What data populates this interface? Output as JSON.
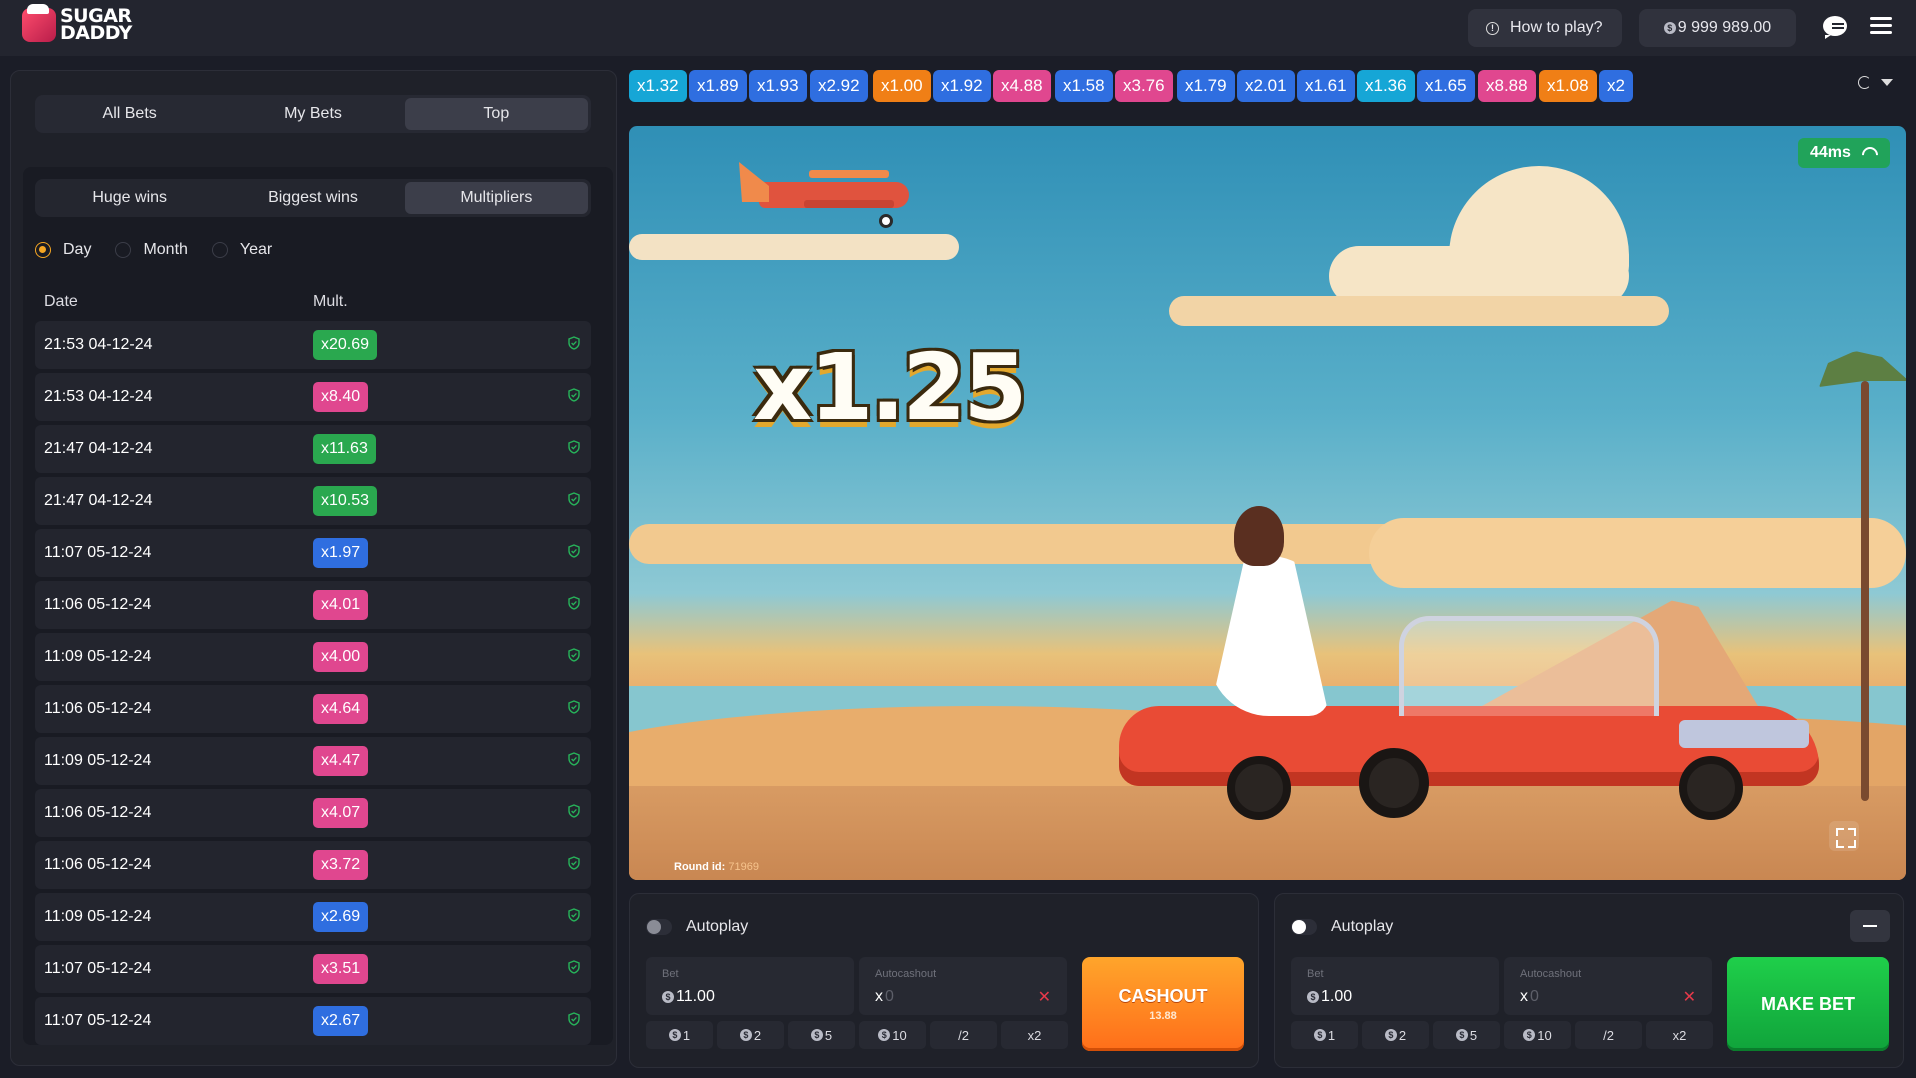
{
  "app": {
    "logo_line1": "SUGAR",
    "logo_line2": "DADDY"
  },
  "header": {
    "how_to_play": "How to play?",
    "balance": "9 999 989.00"
  },
  "bets_tabs": [
    "All Bets",
    "My Bets",
    "Top"
  ],
  "top_tabs": [
    "Huge wins",
    "Biggest wins",
    "Multipliers"
  ],
  "period_options": [
    "Day",
    "Month",
    "Year"
  ],
  "selected_period": "Day",
  "table": {
    "headers": {
      "date": "Date",
      "mult": "Mult."
    },
    "rows": [
      {
        "date": "21:53 04-12-24",
        "mult": "x20.69",
        "color": "#2aa84f"
      },
      {
        "date": "21:53 04-12-24",
        "mult": "x8.40",
        "color": "#e0478f"
      },
      {
        "date": "21:47 04-12-24",
        "mult": "x11.63",
        "color": "#2aa84f"
      },
      {
        "date": "21:47 04-12-24",
        "mult": "x10.53",
        "color": "#2aa84f"
      },
      {
        "date": "11:07 05-12-24",
        "mult": "x1.97",
        "color": "#2f6ee0"
      },
      {
        "date": "11:06 05-12-24",
        "mult": "x4.01",
        "color": "#e0478f"
      },
      {
        "date": "11:09 05-12-24",
        "mult": "x4.00",
        "color": "#e0478f"
      },
      {
        "date": "11:06 05-12-24",
        "mult": "x4.64",
        "color": "#e0478f"
      },
      {
        "date": "11:09 05-12-24",
        "mult": "x4.47",
        "color": "#e0478f"
      },
      {
        "date": "11:06 05-12-24",
        "mult": "x4.07",
        "color": "#e0478f"
      },
      {
        "date": "11:06 05-12-24",
        "mult": "x3.72",
        "color": "#e0478f"
      },
      {
        "date": "11:09 05-12-24",
        "mult": "x2.69",
        "color": "#2f6ee0"
      },
      {
        "date": "11:07 05-12-24",
        "mult": "x3.51",
        "color": "#e0478f"
      },
      {
        "date": "11:07 05-12-24",
        "mult": "x2.67",
        "color": "#2f6ee0"
      }
    ]
  },
  "history": [
    {
      "v": "x1.32",
      "color": "#16a6d6"
    },
    {
      "v": "x1.89",
      "color": "#2f6ee0"
    },
    {
      "v": "x1.93",
      "color": "#2f6ee0"
    },
    {
      "v": "x2.92",
      "color": "#2f6ee0"
    },
    {
      "v": "x1.00",
      "color": "#f07f16"
    },
    {
      "v": "x1.92",
      "color": "#2f6ee0"
    },
    {
      "v": "x4.88",
      "color": "#e0478f"
    },
    {
      "v": "x1.58",
      "color": "#2f6ee0"
    },
    {
      "v": "x3.76",
      "color": "#e0478f"
    },
    {
      "v": "x1.79",
      "color": "#2f6ee0"
    },
    {
      "v": "x2.01",
      "color": "#2f6ee0"
    },
    {
      "v": "x1.61",
      "color": "#2f6ee0"
    },
    {
      "v": "x1.36",
      "color": "#16a6d6"
    },
    {
      "v": "x1.65",
      "color": "#2f6ee0"
    },
    {
      "v": "x8.88",
      "color": "#e0478f"
    },
    {
      "v": "x1.08",
      "color": "#f07f16"
    },
    {
      "v": "x2",
      "color": "#2f6ee0"
    }
  ],
  "game": {
    "multiplier": "x1.25",
    "ping": "44ms",
    "round_label": "Round id:",
    "round_id": "71969"
  },
  "panel1": {
    "autoplay": "Autoplay",
    "bet_label": "Bet",
    "bet_value": "11.00",
    "autocashout_label": "Autocashout",
    "autocashout_prefix": "x",
    "autocashout_placeholder": "0",
    "action": "CASHOUT",
    "action_sub": "13.88"
  },
  "panel2": {
    "autoplay": "Autoplay",
    "bet_label": "Bet",
    "bet_value": "1.00",
    "autocashout_label": "Autocashout",
    "autocashout_prefix": "x",
    "autocashout_placeholder": "0",
    "action": "MAKE BET"
  },
  "quick_amounts": [
    "1",
    "2",
    "5",
    "10"
  ],
  "quick_ops": [
    "/2",
    "x2"
  ]
}
